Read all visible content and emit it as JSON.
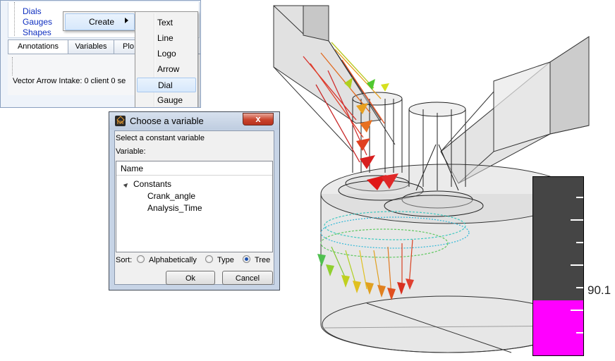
{
  "annotations_panel": {
    "tree_items": [
      "Dials",
      "Gauges",
      "Shapes"
    ],
    "tabs": [
      "Annotations",
      "Variables",
      "Plo"
    ],
    "active_tab": "Annotations",
    "status": "Vector Arrow Intake: 0 client 0 se"
  },
  "context_menu": {
    "create_label": "Create",
    "submenu": [
      "Text",
      "Line",
      "Logo",
      "Arrow",
      "Dial",
      "Gauge"
    ],
    "highlighted": "Dial"
  },
  "dialog": {
    "title": "Choose a variable",
    "close_label": "x",
    "select_label": "Select a constant variable",
    "variable_label": "Variable:",
    "list_header": "Name",
    "group": "Constants",
    "items": [
      "Crank_angle",
      "Analysis_Time"
    ],
    "sort_label": "Sort:",
    "sort_options": [
      "Alphabetically",
      "Type",
      "Tree"
    ],
    "sort_selected": "Tree",
    "ok_label": "Ok",
    "cancel_label": "Cancel"
  },
  "gauge": {
    "value_text": "90.1",
    "fill_fraction": 0.31,
    "fill_color": "#ff00ff",
    "background_color": "#454545"
  },
  "icons": [
    "ensight-logo-icon",
    "close-icon",
    "submenu-arrow-icon",
    "expand-triangle-icon"
  ]
}
